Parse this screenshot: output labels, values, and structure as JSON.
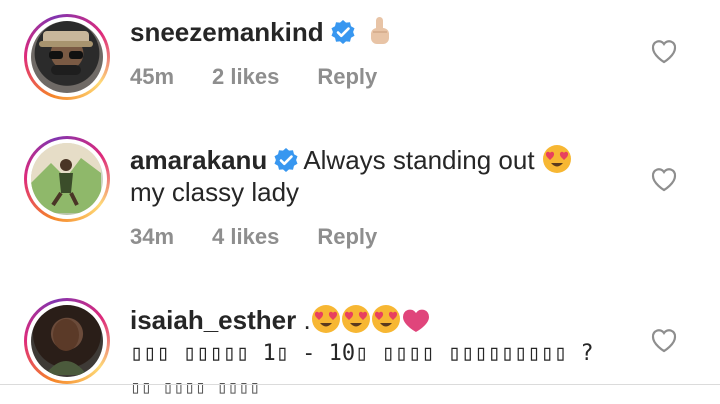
{
  "comments": [
    {
      "username": "sneezemankind",
      "verified": true,
      "text": "",
      "emoji": [
        "pointing-up-icon"
      ],
      "time": "45m",
      "likes": "2 likes",
      "reply": "Reply"
    },
    {
      "username": "amarakanu",
      "verified": true,
      "text": "Always standing out",
      "text_line2": "my classy lady",
      "emoji": [
        "heart-eyes-icon"
      ],
      "time": "34m",
      "likes": "4 likes",
      "reply": "Reply"
    },
    {
      "username": "isaiah_esther",
      "verified": false,
      "text": ".",
      "emoji": [
        "heart-eyes-icon",
        "heart-eyes-icon",
        "heart-eyes-icon",
        "pink-heart-icon"
      ],
      "text_line2": "▯▯▯ ▯▯▯▯▯ 1▯ - 10▯ ▯▯▯▯ ▯▯▯▯▯▯▯▯▯ ?",
      "text_line3": "▯▯ ▯▯▯▯ ▯▯▯▯"
    }
  ],
  "colors": {
    "meta_gray": "#8e8e8e",
    "verified_blue": "#3897f0",
    "heart_pink": "#e0457b"
  }
}
